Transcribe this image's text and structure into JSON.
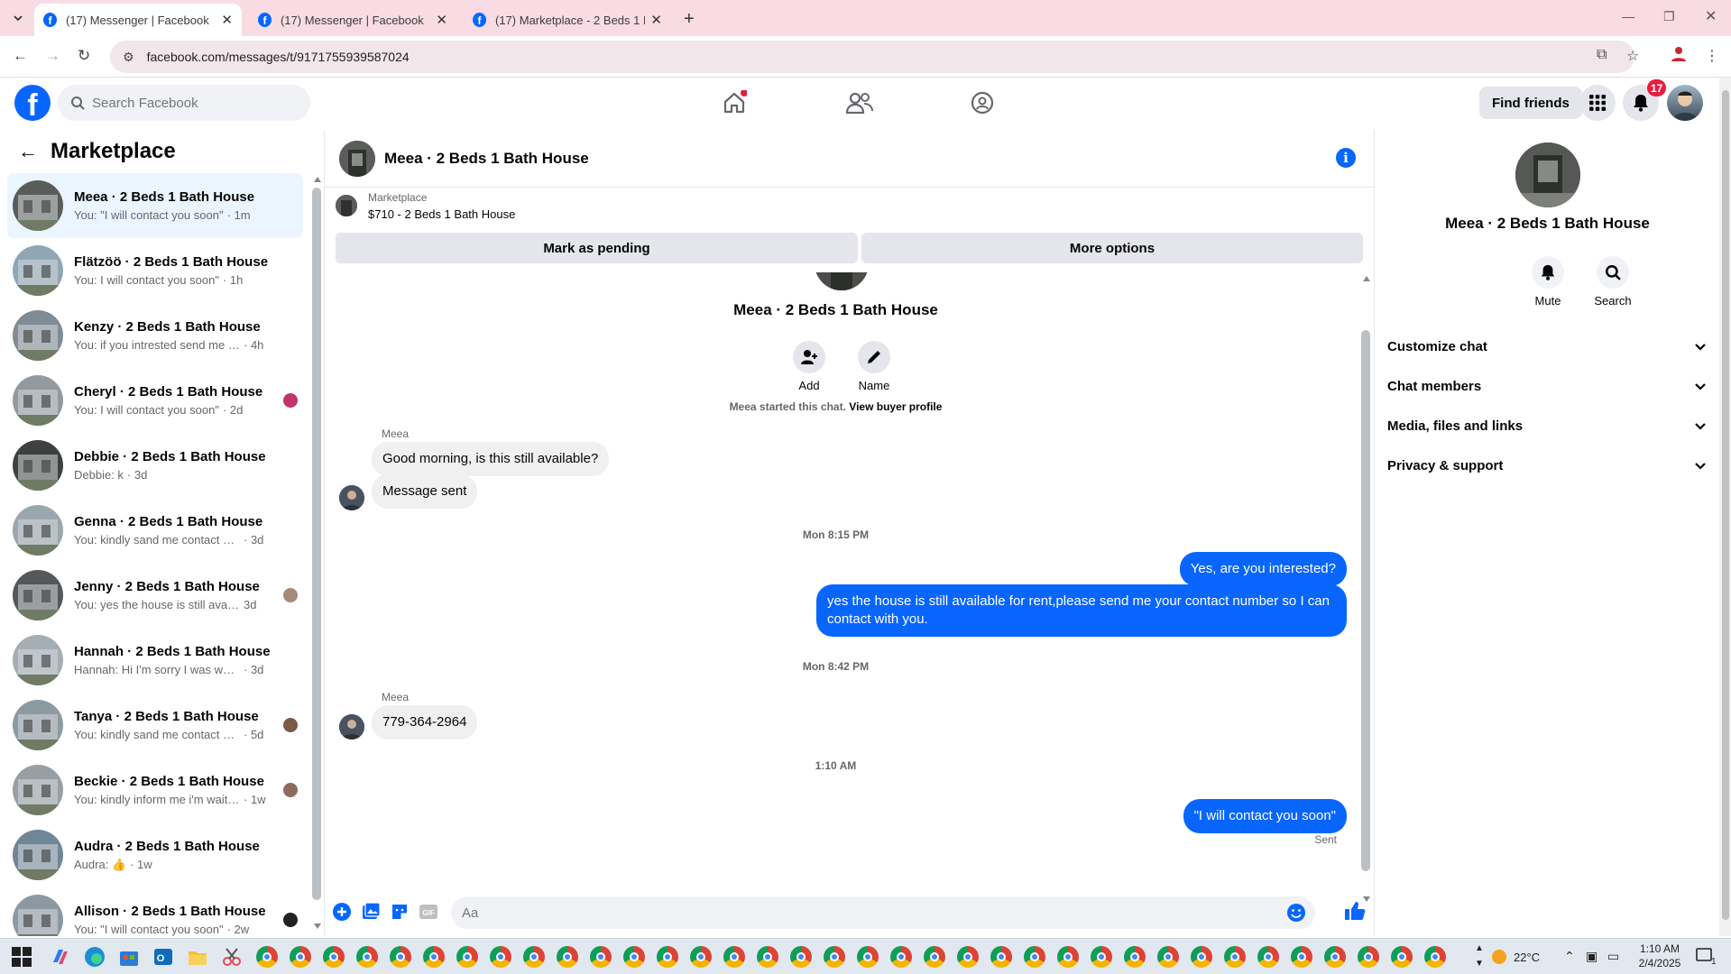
{
  "browser": {
    "tabs": [
      {
        "title": "(17) Messenger | Facebook",
        "active": true
      },
      {
        "title": "(17) Messenger | Facebook",
        "active": false
      },
      {
        "title": "(17) Marketplace - 2 Beds 1 Bath",
        "active": false
      }
    ],
    "url": "facebook.com/messages/t/9171755939587024"
  },
  "fb": {
    "search_placeholder": "Search Facebook",
    "find_friends": "Find friends",
    "notifications_count": "17"
  },
  "sidebar": {
    "title": "Marketplace",
    "conversations": [
      {
        "name": "Meea · 2 Beds 1 Bath House",
        "preview": "You: \"I will contact you soon\"",
        "time": "· 1m",
        "selected": true
      },
      {
        "name": "Flätzöö · 2 Beds 1 Bath House",
        "preview": "You: I will contact you soon\"",
        "time": "· 1h"
      },
      {
        "name": "Kenzy · 2 Beds 1 Bath House",
        "preview": "You: if you intrested send me your ...",
        "time": "· 4h"
      },
      {
        "name": "Cheryl · 2 Beds 1 Bath House",
        "preview": "You: I will contact you soon\"",
        "time": "· 2d"
      },
      {
        "name": "Debbie · 2 Beds 1 Bath House",
        "preview": "Debbie: k",
        "time": "· 3d"
      },
      {
        "name": "Genna · 2 Beds 1 Bath House",
        "preview": "You: kindly sand me contact numb...",
        "time": "· 3d"
      },
      {
        "name": "Jenny · 2 Beds 1 Bath House",
        "preview": "You: yes the house is still availab...",
        "time": "3d"
      },
      {
        "name": "Hannah · 2 Beds 1 Bath House",
        "preview": "Hannah: Hi I'm sorry I was working...",
        "time": "· 3d"
      },
      {
        "name": "Tanya · 2 Beds 1 Bath House",
        "preview": "You: kindly sand me contact nu...",
        "time": "· 5d"
      },
      {
        "name": "Beckie · 2 Beds 1 Bath House",
        "preview": "You: kindly inform me i'm waitin...",
        "time": "· 1w"
      },
      {
        "name": "Audra · 2 Beds 1 Bath House",
        "preview": "Audra: 👍",
        "time": "· 1w"
      },
      {
        "name": "Allison · 2 Beds 1 Bath House",
        "preview": "You: \"I will contact you soon\"",
        "time": "· 2w"
      }
    ]
  },
  "chat": {
    "title": "Meea · 2 Beds 1 Bath House",
    "listing_source": "Marketplace",
    "listing_title": "$710 - 2 Beds 1 Bath House",
    "mark_pending": "Mark as pending",
    "more_options": "More options",
    "profile_name": "Meea · 2 Beds 1 Bath House",
    "add_label": "Add",
    "name_label": "Name",
    "started_text": "Meea started this chat.",
    "view_buyer": "View buyer profile",
    "sender": "Meea",
    "msg1": "Good morning, is this still available?",
    "msg2": "Message sent",
    "time1": "Mon 8:15 PM",
    "msg3": "Yes, are you interested?",
    "msg4": "yes the house is still available for rent,please send me your contact number so I can contact with you.",
    "time2": "Mon 8:42 PM",
    "msg5": "779-364-2964",
    "time3": "1:10 AM",
    "msg6": "\"I will contact you soon\"",
    "sent_status": "Sent",
    "composer_placeholder": "Aa"
  },
  "info_panel": {
    "name": "Meea · 2 Beds 1 Bath House",
    "mute": "Mute",
    "search": "Search",
    "sections": [
      "Customize chat",
      "Chat members",
      "Media, files and links",
      "Privacy & support"
    ]
  },
  "taskbar": {
    "weather": "22°C",
    "time": "1:10 AM",
    "date": "2/4/2025",
    "notif": "1"
  }
}
